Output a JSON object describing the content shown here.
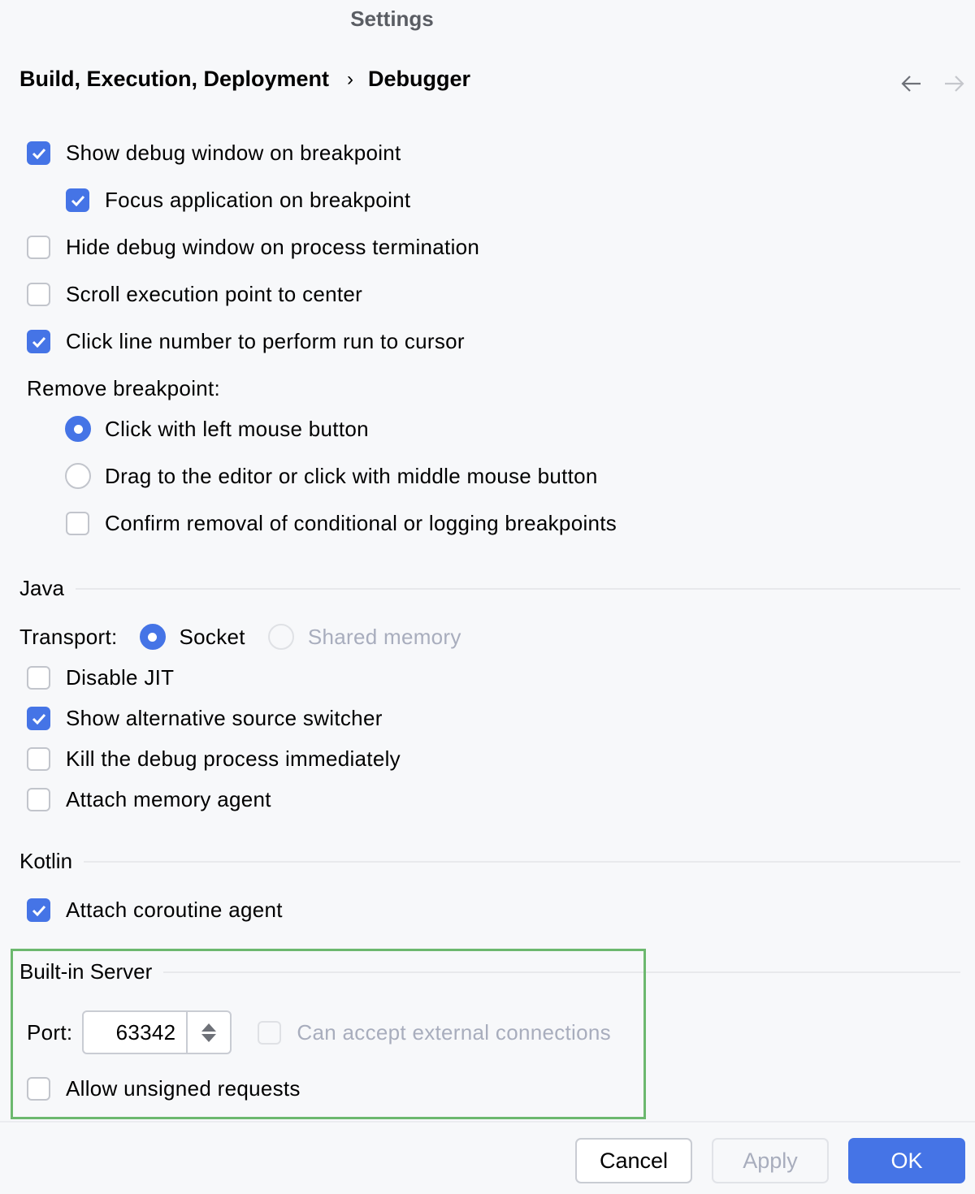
{
  "window": {
    "title": "Settings"
  },
  "breadcrumb": {
    "parent": "Build, Execution, Deployment",
    "separator": "›",
    "current": "Debugger"
  },
  "nav": {
    "back_icon": "arrow-left-icon",
    "forward_icon": "arrow-right-icon"
  },
  "general": {
    "show_debug_window": {
      "label": "Show debug window on breakpoint",
      "checked": true
    },
    "focus_application": {
      "label": "Focus application on breakpoint",
      "checked": true
    },
    "hide_debug_window": {
      "label": "Hide debug window on process termination",
      "checked": false
    },
    "scroll_execution_point": {
      "label": "Scroll execution point to center",
      "checked": false
    },
    "click_line_number": {
      "label": "Click line number to perform run to cursor",
      "checked": true
    },
    "remove_breakpoint_label": "Remove breakpoint:",
    "remove_options": [
      {
        "label": "Click with left mouse button",
        "selected": true
      },
      {
        "label": "Drag to the editor or click with middle mouse button",
        "selected": false
      }
    ],
    "confirm_removal": {
      "label": "Confirm removal of conditional or logging breakpoints",
      "checked": false
    }
  },
  "java": {
    "title": "Java",
    "transport_label": "Transport:",
    "transport_options": [
      {
        "label": "Socket",
        "selected": true,
        "enabled": true
      },
      {
        "label": "Shared memory",
        "selected": false,
        "enabled": false
      }
    ],
    "disable_jit": {
      "label": "Disable JIT",
      "checked": false
    },
    "alt_source_switcher": {
      "label": "Show alternative source switcher",
      "checked": true
    },
    "kill_debug_process": {
      "label": "Kill the debug process immediately",
      "checked": false
    },
    "attach_memory_agent": {
      "label": "Attach memory agent",
      "checked": false
    }
  },
  "kotlin": {
    "title": "Kotlin",
    "attach_coroutine_agent": {
      "label": "Attach coroutine agent",
      "checked": true
    }
  },
  "builtin_server": {
    "title": "Built-in Server",
    "port_label": "Port:",
    "port_value": "63342",
    "external_connections": {
      "label": "Can accept external connections",
      "checked": false,
      "enabled": false
    },
    "allow_unsigned": {
      "label": "Allow unsigned requests",
      "checked": false
    }
  },
  "footer": {
    "cancel": "Cancel",
    "apply": "Apply",
    "ok": "OK"
  },
  "colors": {
    "accent": "#4574e6",
    "highlight_border": "#6cb86e",
    "disabled_text": "#a8adbd"
  }
}
